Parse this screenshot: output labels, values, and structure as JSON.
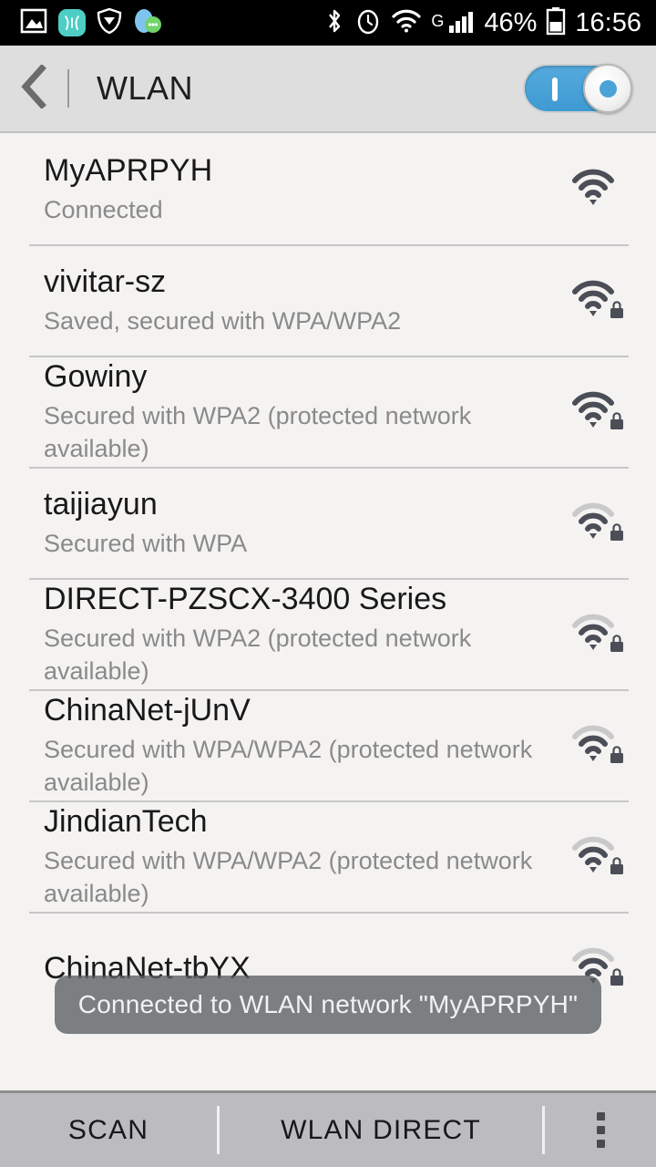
{
  "statusbar": {
    "time": "16:56",
    "battery_percent": "46%",
    "network_type": "G",
    "left_icons": [
      "gallery-icon",
      "huawei-icon",
      "shield-icon",
      "qq-icon"
    ],
    "right_icons": [
      "bluetooth-icon",
      "alarm-icon",
      "wifi-icon",
      "signal-bars-icon",
      "battery-icon"
    ]
  },
  "header": {
    "title": "WLAN",
    "back_icon": "back-chevron-icon",
    "toggle_state": "on",
    "toggle_accent": "#4aa3d6"
  },
  "networks": [
    {
      "ssid": "MyAPRPYH",
      "status": "Connected",
      "signal": 4,
      "secured": false
    },
    {
      "ssid": "vivitar-sz",
      "status": "Saved, secured with WPA/WPA2",
      "signal": 4,
      "secured": true
    },
    {
      "ssid": "Gowiny",
      "status": "Secured with WPA2 (protected network available)",
      "signal": 4,
      "secured": true
    },
    {
      "ssid": "taijiayun",
      "status": "Secured with WPA",
      "signal": 3,
      "secured": true
    },
    {
      "ssid": "DIRECT-PZSCX-3400 Series",
      "status": "Secured with WPA2 (protected network available)",
      "signal": 3,
      "secured": true
    },
    {
      "ssid": "ChinaNet-jUnV",
      "status": "Secured with WPA/WPA2 (protected network available)",
      "signal": 3,
      "secured": true
    },
    {
      "ssid": "JindianTech",
      "status": "Secured with WPA/WPA2 (protected network available)",
      "signal": 3,
      "secured": true
    },
    {
      "ssid": "ChinaNet-tbYX",
      "status": "",
      "signal": 3,
      "secured": true
    }
  ],
  "toast": {
    "message": "Connected to WLAN network \"MyAPRPYH\""
  },
  "bottom_bar": {
    "scan_label": "SCAN",
    "wlan_direct_label": "WLAN DIRECT",
    "overflow_icon": "overflow-menu-icon"
  },
  "colors": {
    "list_background": "#f4f3f1",
    "header_background": "#dedede",
    "bottom_background": "#bcbcbe",
    "divider": "#c7c7c9",
    "title_text": "#191919",
    "status_text": "#8a8a8a",
    "toggle_blue": "#4aa3d6"
  }
}
